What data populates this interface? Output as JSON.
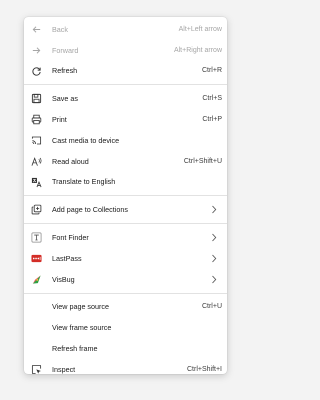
{
  "menu": {
    "items": [
      {
        "label": "Back",
        "shortcut": "Alt+Left arrow",
        "icon": "arrow-left-icon",
        "enabled": false
      },
      {
        "label": "Forward",
        "shortcut": "Alt+Right arrow",
        "icon": "arrow-right-icon",
        "enabled": false
      },
      {
        "label": "Refresh",
        "shortcut": "Ctrl+R",
        "icon": "refresh-icon",
        "enabled": true
      },
      {
        "label": "Save as",
        "shortcut": "Ctrl+S",
        "icon": "save-icon",
        "enabled": true
      },
      {
        "label": "Print",
        "shortcut": "Ctrl+P",
        "icon": "printer-icon",
        "enabled": true
      },
      {
        "label": "Cast media to device",
        "shortcut": "",
        "icon": "cast-icon",
        "enabled": true
      },
      {
        "label": "Read aloud",
        "shortcut": "Ctrl+Shift+U",
        "icon": "read-aloud-icon",
        "enabled": true
      },
      {
        "label": "Translate to English",
        "shortcut": "",
        "icon": "translate-icon",
        "enabled": true
      },
      {
        "label": "Add page to Collections",
        "shortcut": "",
        "icon": "collections-icon",
        "enabled": true,
        "submenu": true
      },
      {
        "label": "Font Finder",
        "shortcut": "",
        "icon": "font-finder-icon",
        "enabled": true,
        "submenu": true
      },
      {
        "label": "LastPass",
        "shortcut": "",
        "icon": "lastpass-icon",
        "enabled": true,
        "submenu": true
      },
      {
        "label": "VisBug",
        "shortcut": "",
        "icon": "visbug-icon",
        "enabled": true,
        "submenu": true
      },
      {
        "label": "View page source",
        "shortcut": "Ctrl+U",
        "icon": "",
        "enabled": true
      },
      {
        "label": "View frame source",
        "shortcut": "",
        "icon": "",
        "enabled": true
      },
      {
        "label": "Refresh frame",
        "shortcut": "",
        "icon": "",
        "enabled": true
      },
      {
        "label": "Inspect",
        "shortcut": "Ctrl+Shift+I",
        "icon": "inspect-icon",
        "enabled": true
      }
    ]
  },
  "colors": {
    "lastpass_red": "#d32d27",
    "visbug_green": "#2ea043"
  }
}
